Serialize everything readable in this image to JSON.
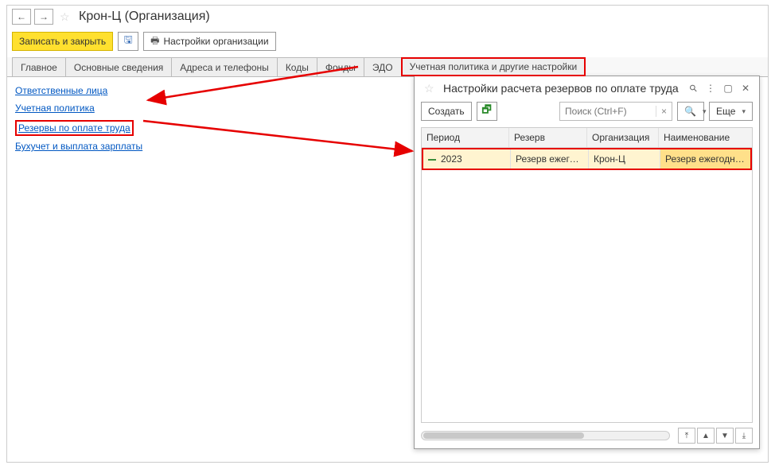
{
  "header": {
    "title": "Крон-Ц (Организация)"
  },
  "toolbar": {
    "save_close": "Записать и закрыть",
    "org_settings": "Настройки организации"
  },
  "tabs": [
    {
      "label": "Главное"
    },
    {
      "label": "Основные сведения"
    },
    {
      "label": "Адреса и телефоны"
    },
    {
      "label": "Коды"
    },
    {
      "label": "Фонды"
    },
    {
      "label": "ЭДО"
    },
    {
      "label": "Учетная политика и другие настройки"
    }
  ],
  "links": [
    {
      "label": "Ответственные лица"
    },
    {
      "label": "Учетная политика"
    },
    {
      "label": "Резервы по оплате труда"
    },
    {
      "label": "Бухучет и выплата зарплаты"
    }
  ],
  "popup": {
    "title": "Настройки расчета резервов по оплате труда",
    "create": "Создать",
    "search_placeholder": "Поиск (Ctrl+F)",
    "more": "Еще",
    "columns": {
      "period": "Период",
      "reserve": "Резерв",
      "org": "Организация",
      "name": "Наименование"
    },
    "rows": [
      {
        "period": "2023",
        "reserve": "Резерв ежегод…",
        "org": "Крон-Ц",
        "name": "Резерв ежегодных"
      }
    ]
  }
}
